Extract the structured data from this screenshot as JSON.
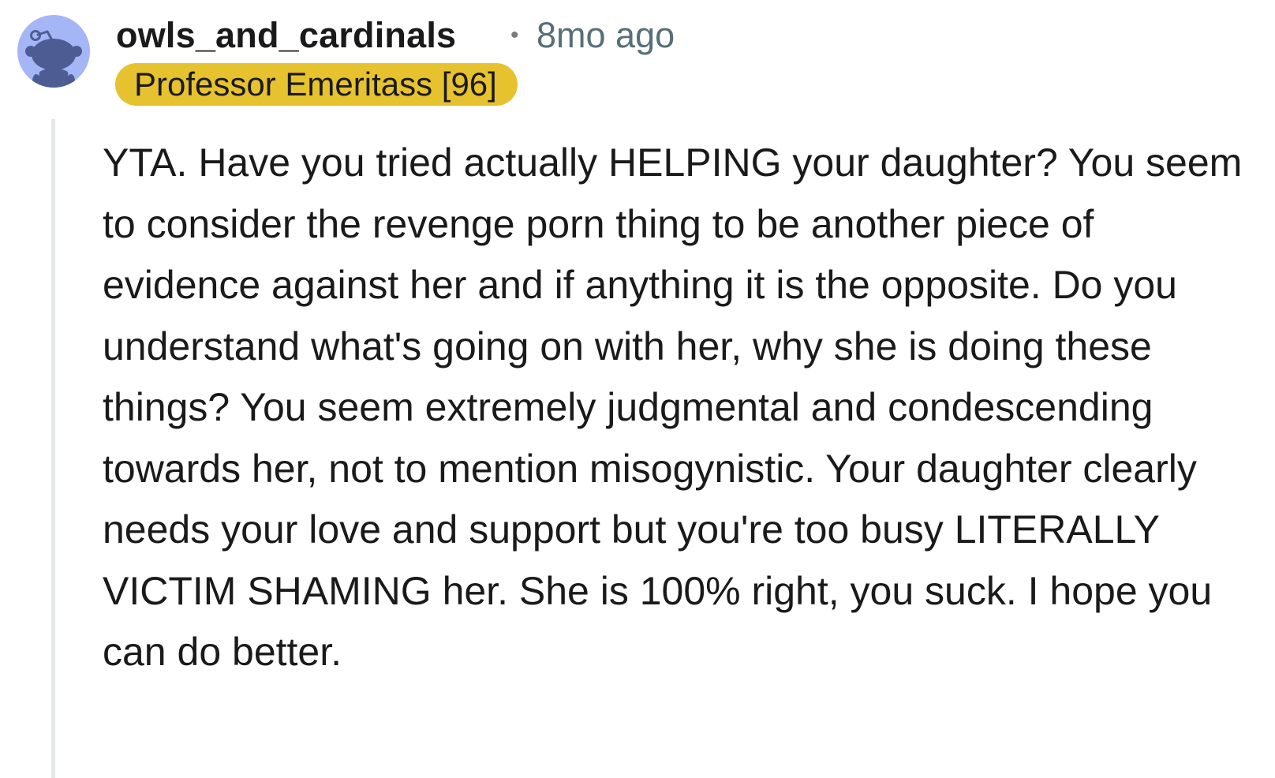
{
  "comment": {
    "username": "owls_and_cardinals",
    "separator": "•",
    "timestamp": "8mo ago",
    "flair": "Professor Emeritass [96]",
    "body": "YTA. Have you tried actually HELPING your daughter? You seem to consider the revenge porn thing to be another piece of evidence against her and if anything it is the opposite. Do you understand what's going on with her, why she is doing these things? You seem extremely judgmental and condescending towards her, not to mention misogynistic. Your daughter clearly needs your love and support but you're too busy LITERALLY VICTIM SHAMING her. She is 100% right, you suck. I hope you can do better."
  },
  "colors": {
    "avatar_bg": "#a4b6f5",
    "avatar_figure": "#4d5d93",
    "flair_bg": "#e6c22f",
    "thread_line": "#e5e8ea",
    "timestamp": "#576f76"
  },
  "icons": {
    "avatar": "reddit-snoo-avatar-icon"
  }
}
